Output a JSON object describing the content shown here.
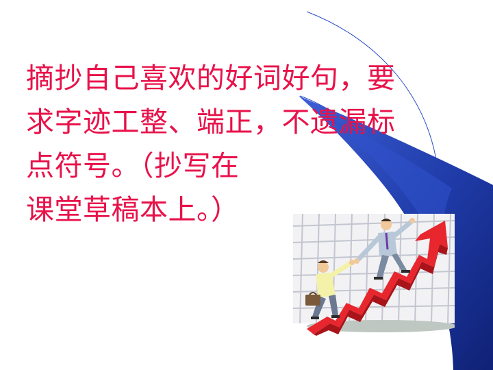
{
  "slide": {
    "lines": [
      "摘抄自己喜欢的好词好句，要",
      "求字迹工整、端正，不遗漏标",
      "点符号。（抄写在",
      "课堂草稿本上。）"
    ],
    "colors": {
      "text": "#e8124a",
      "swoosh_blue": "#1f3ba8",
      "swoosh_dark": "#0f2175",
      "arrow_red": "#e8262e"
    },
    "decoration_icon": "blue-swoosh-icon",
    "clipart_icon": "climbing-businessmen-arrow-icon"
  }
}
